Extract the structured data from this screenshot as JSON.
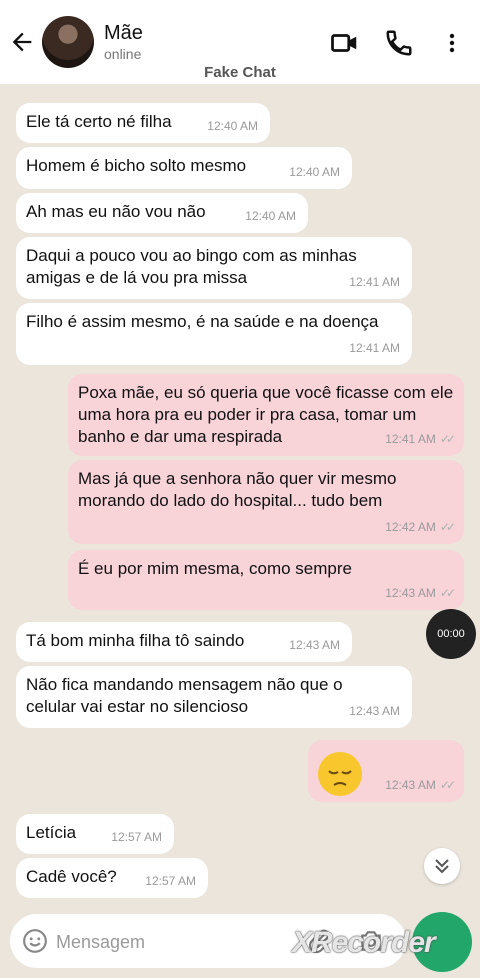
{
  "header": {
    "contact_name": "Mãe",
    "contact_status": "online",
    "fake_label": "Fake Chat"
  },
  "messages": [
    {
      "dir": "in",
      "text": "Ele tá certo né filha",
      "time": "12:40 AM"
    },
    {
      "dir": "in",
      "text": "Homem é bicho solto mesmo",
      "time": "12:40 AM"
    },
    {
      "dir": "in",
      "text": "Ah mas eu não vou não",
      "time": "12:40 AM"
    },
    {
      "dir": "in",
      "text": "Daqui a pouco vou ao bingo com as minhas amigas e de lá vou pra missa",
      "time": "12:41 AM"
    },
    {
      "dir": "in",
      "text": "Filho é assim mesmo, é na saúde e na doença",
      "time": "12:41 AM"
    },
    {
      "dir": "out",
      "text": "Poxa mãe, eu só queria que você ficasse com ele uma hora pra eu poder ir pra casa, tomar um banho e dar uma respirada",
      "time": "12:41 AM"
    },
    {
      "dir": "out",
      "text": "Mas já que a senhora não quer vir mesmo morando do lado do hospital... tudo bem",
      "time": "12:42 AM"
    },
    {
      "dir": "out",
      "text": "É eu por mim mesma, como sempre",
      "time": "12:43 AM"
    },
    {
      "dir": "in",
      "text": "Tá bom minha filha tô saindo",
      "time": "12:43 AM"
    },
    {
      "dir": "in",
      "text": "Não fica mandando mensagem não que o celular vai estar no silencioso",
      "time": "12:43 AM"
    },
    {
      "dir": "out",
      "text": "",
      "time": "12:43 AM",
      "emoji": "pensive-face"
    },
    {
      "dir": "in",
      "text": "Letícia",
      "time": "12:57 AM"
    },
    {
      "dir": "in",
      "text": "Cadê você?",
      "time": "12:57 AM"
    }
  ],
  "timer": "00:00",
  "input": {
    "placeholder": "Mensagem"
  },
  "watermark": "XRecorder",
  "colors": {
    "incoming": "#ffffff",
    "outgoing": "#f8d3d8",
    "send_button": "#22a66a",
    "background": "#ebe5dc"
  }
}
